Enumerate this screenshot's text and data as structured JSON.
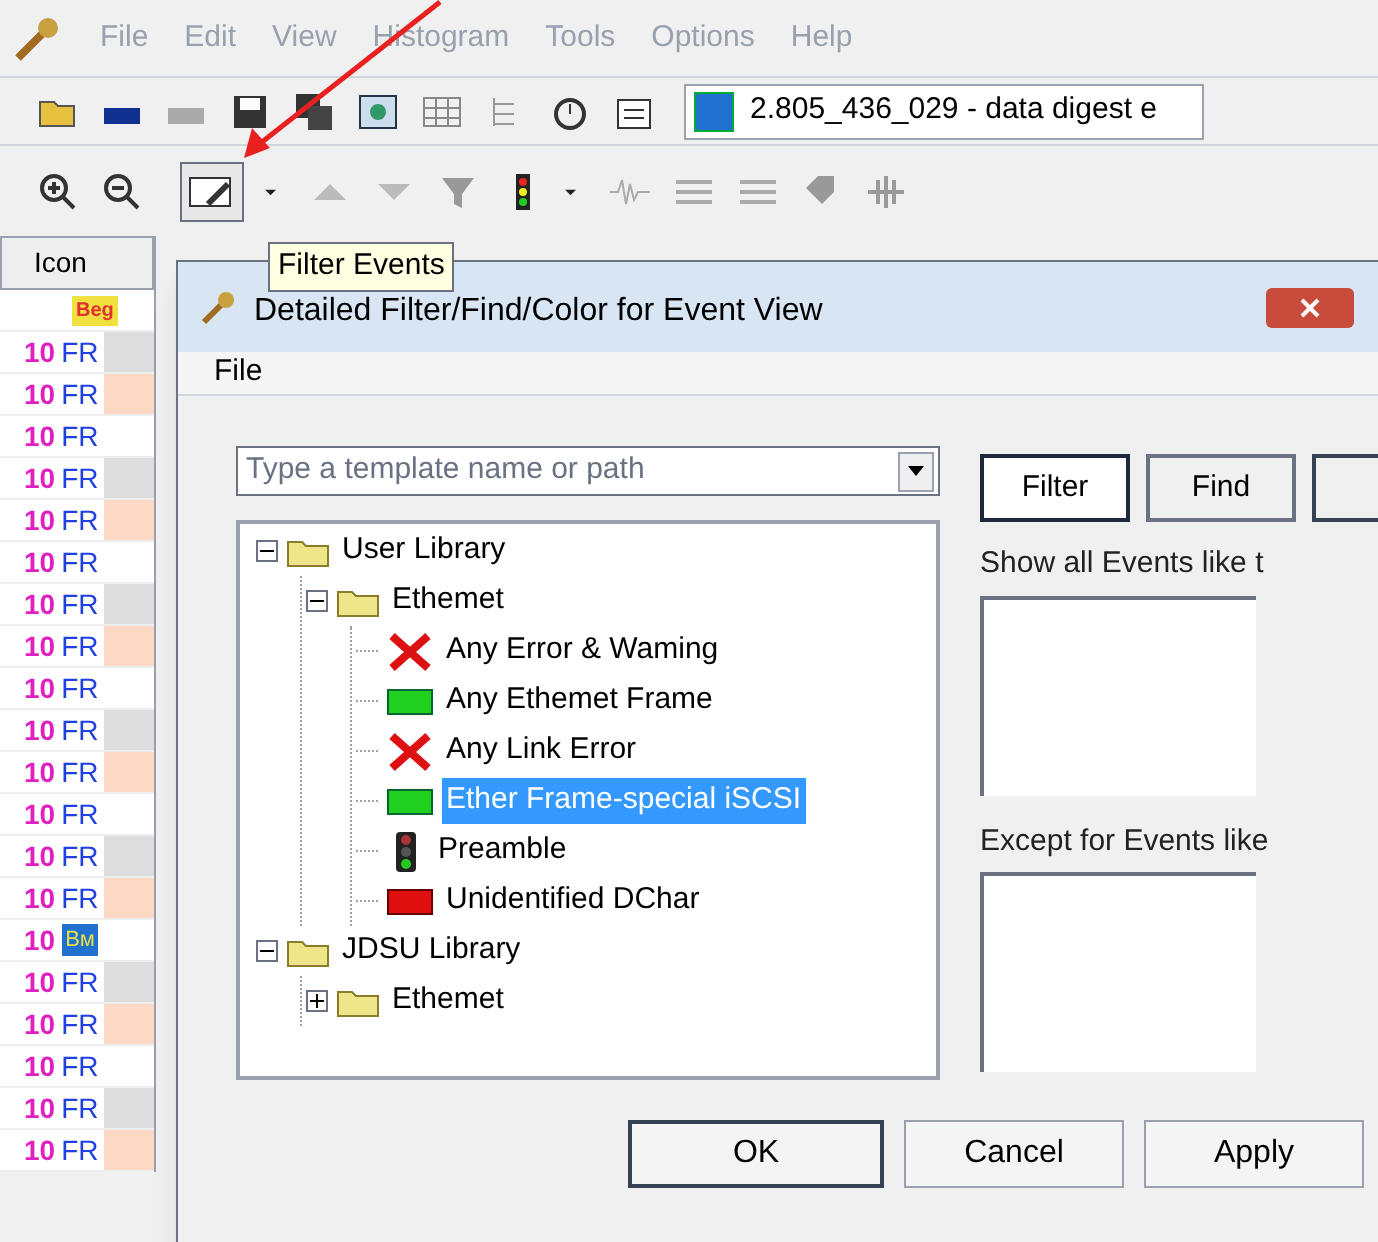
{
  "menu": [
    "File",
    "Edit",
    "View",
    "Histogram",
    "Tools",
    "Options",
    "Help"
  ],
  "document_title": "2.805_436_029 - data digest e",
  "tooltip": "Filter Events",
  "grid": {
    "header": "Icon",
    "rows": [
      {
        "kind": "begin",
        "num": "",
        "code": "Beg"
      },
      {
        "kind": "frame",
        "num": "10",
        "code": "FR"
      },
      {
        "kind": "frame",
        "num": "10",
        "code": "FR"
      },
      {
        "kind": "frame",
        "num": "10",
        "code": "FR"
      },
      {
        "kind": "frame",
        "num": "10",
        "code": "FR"
      },
      {
        "kind": "frame",
        "num": "10",
        "code": "FR"
      },
      {
        "kind": "frame",
        "num": "10",
        "code": "FR"
      },
      {
        "kind": "frame",
        "num": "10",
        "code": "FR"
      },
      {
        "kind": "frame",
        "num": "10",
        "code": "FR"
      },
      {
        "kind": "frame",
        "num": "10",
        "code": "FR"
      },
      {
        "kind": "frame",
        "num": "10",
        "code": "FR"
      },
      {
        "kind": "frame",
        "num": "10",
        "code": "FR"
      },
      {
        "kind": "frame",
        "num": "10",
        "code": "FR"
      },
      {
        "kind": "frame",
        "num": "10",
        "code": "FR"
      },
      {
        "kind": "frame",
        "num": "10",
        "code": "FR"
      },
      {
        "kind": "bookmark",
        "num": "10",
        "code": "Bм"
      },
      {
        "kind": "frame",
        "num": "10",
        "code": "FR"
      },
      {
        "kind": "frame",
        "num": "10",
        "code": "FR"
      },
      {
        "kind": "frame",
        "num": "10",
        "code": "FR"
      },
      {
        "kind": "frame",
        "num": "10",
        "code": "FR"
      },
      {
        "kind": "frame",
        "num": "10",
        "code": "FR"
      }
    ]
  },
  "dialog": {
    "title": "Detailed Filter/Find/Color for Event View",
    "menu": [
      "File"
    ],
    "template": {
      "placeholder": "Type a template name or path"
    },
    "tree": [
      {
        "label": "User Library",
        "kind": "folder",
        "expanded": true,
        "selected": false,
        "children": [
          {
            "label": "Ethemet",
            "kind": "folder",
            "expanded": true,
            "selected": false,
            "children": [
              {
                "label": "Any Error & Waming",
                "kind": "error",
                "selected": false
              },
              {
                "label": "Any Ethemet Frame",
                "kind": "frame",
                "selected": false
              },
              {
                "label": "Any Link Error",
                "kind": "error",
                "selected": false
              },
              {
                "label": "Ether Frame-special iSCSI",
                "kind": "frame",
                "selected": true
              },
              {
                "label": "Preamble",
                "kind": "light",
                "selected": false
              },
              {
                "label": "Unidentified DChar",
                "kind": "bad-frame",
                "selected": false
              }
            ]
          }
        ]
      },
      {
        "label": "JDSU Library",
        "kind": "folder",
        "expanded": true,
        "selected": false,
        "children": [
          {
            "label": "Ethemet",
            "kind": "folder",
            "expanded": false,
            "selected": false
          }
        ]
      }
    ],
    "tabs": [
      {
        "label": "Filter",
        "selected": true
      },
      {
        "label": "Find",
        "selected": false
      }
    ],
    "show_label": "Show all Events like t",
    "except_label": "Except for Events like",
    "buttons": [
      "OK",
      "Cancel",
      "Apply"
    ]
  }
}
